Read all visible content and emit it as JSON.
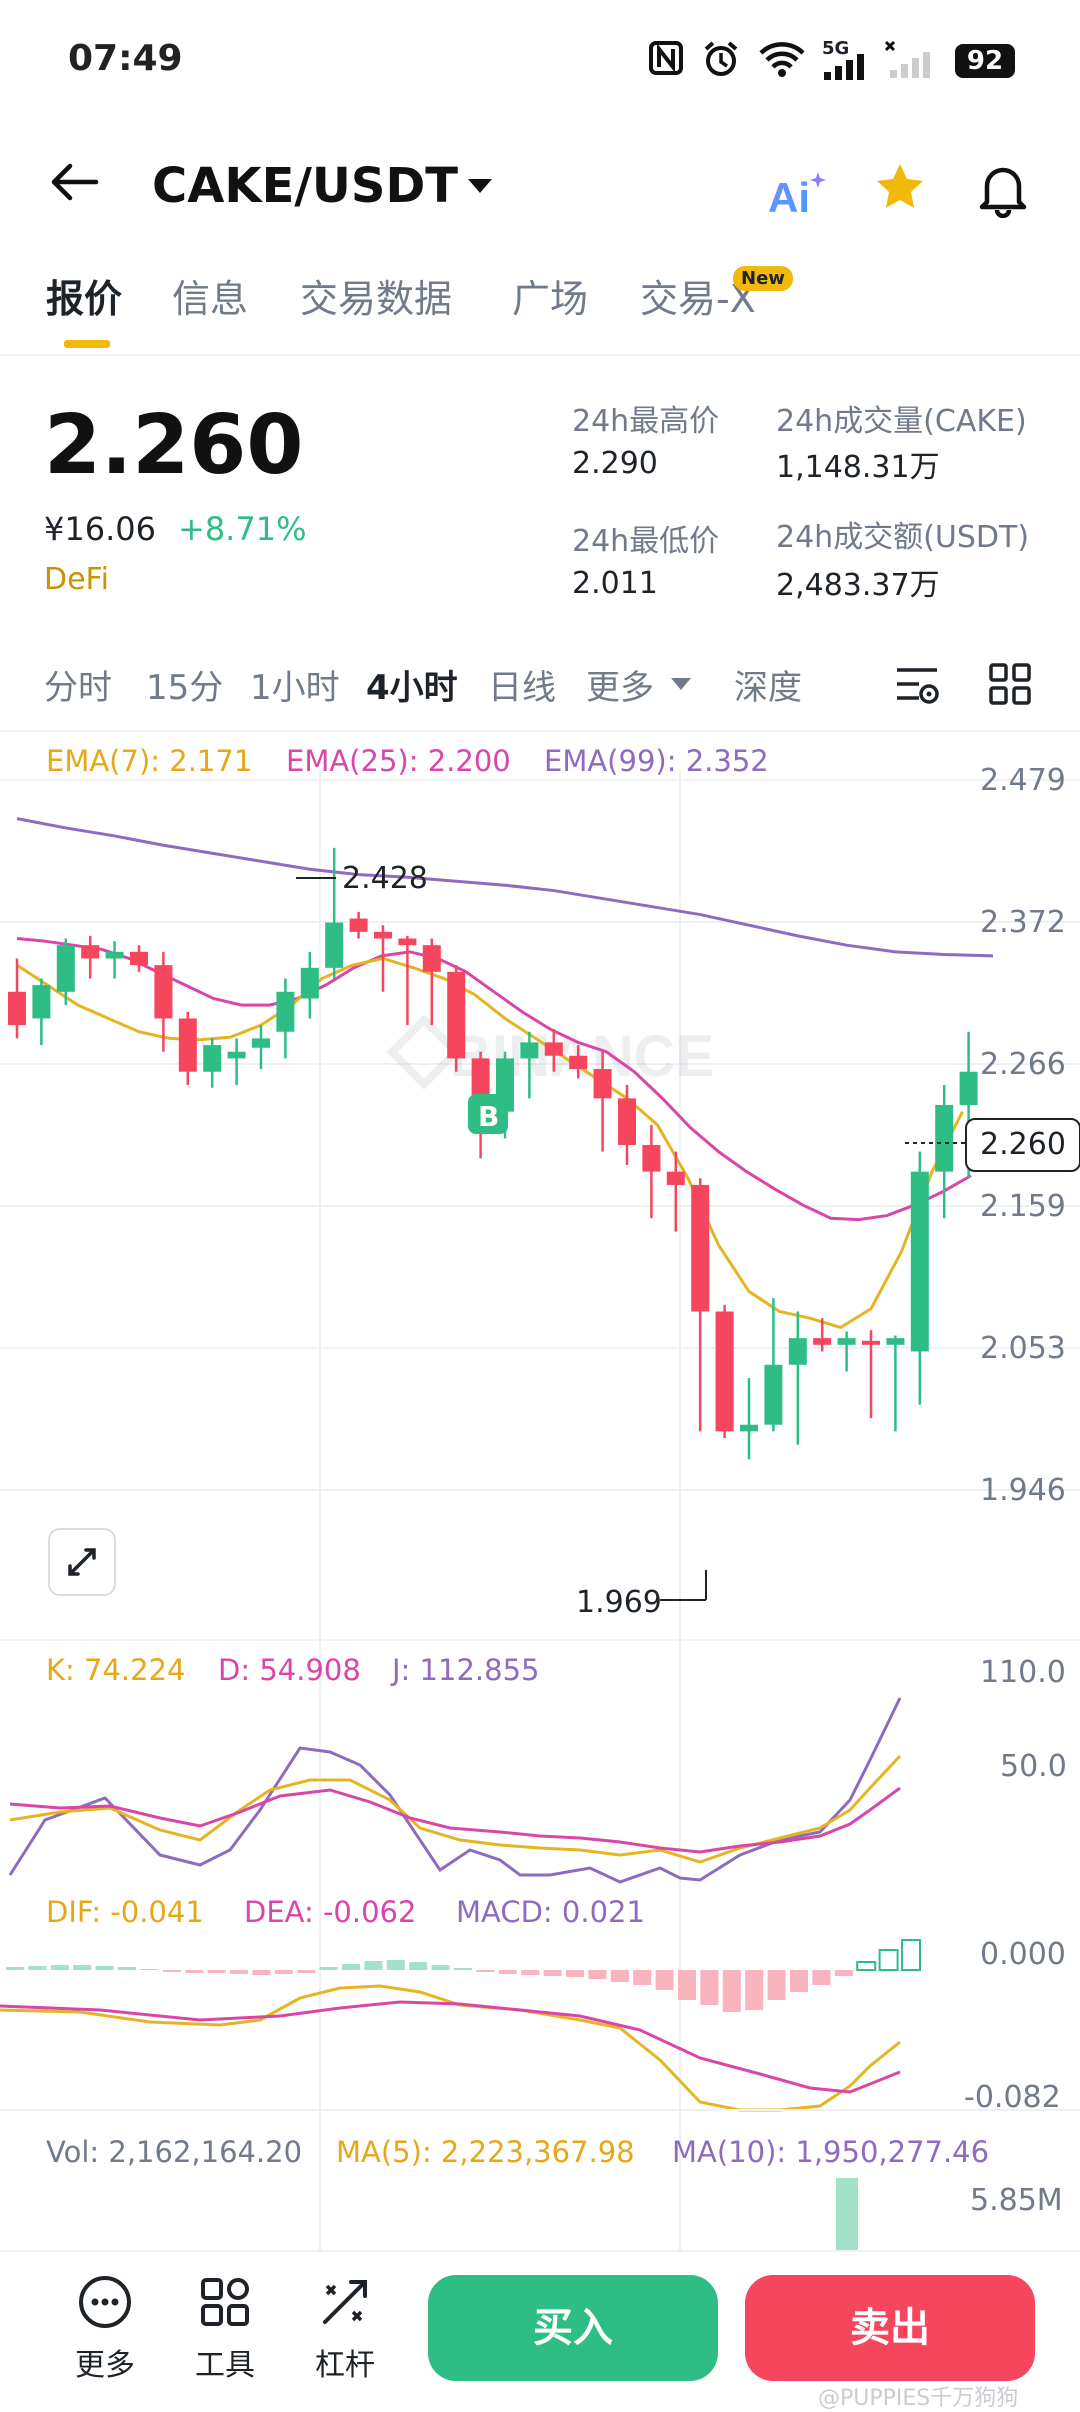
{
  "status": {
    "time": "07:49",
    "network": "5G",
    "battery": "92"
  },
  "header": {
    "pair": "CAKE/USDT"
  },
  "tabs": [
    {
      "label": "报价"
    },
    {
      "label": "信息"
    },
    {
      "label": "交易数据"
    },
    {
      "label": "广场"
    },
    {
      "label": "交易-X"
    }
  ],
  "new_badge": "New",
  "ticker": {
    "last_price": "2.260",
    "cny_price": "¥16.06",
    "change": "+8.71%",
    "tag": "DeFi",
    "high_label": "24h最高价",
    "high": "2.290",
    "low_label": "24h最低价",
    "low": "2.011",
    "vol_label": "24h成交量(CAKE)",
    "vol": "1,148.31万",
    "amt_label": "24h成交额(USDT)",
    "amt": "2,483.37万"
  },
  "intervals": [
    "分时",
    "15分",
    "1小时",
    "4小时",
    "日线",
    "更多",
    "深度"
  ],
  "ema": {
    "ema7": "EMA(7): 2.171",
    "ema25": "EMA(25): 2.200",
    "ema99": "EMA(99): 2.352"
  },
  "price_axis": [
    "2.479",
    "2.372",
    "2.266",
    "2.159",
    "2.053",
    "1.946"
  ],
  "price_tag": "2.260",
  "high_marker": "2.428",
  "low_marker": "1.969",
  "marker_b": "B",
  "watermark": "BINANCE",
  "kdj": {
    "k": "K: 74.224",
    "d": "D: 54.908",
    "j": "J: 112.855",
    "axis": [
      "110.0",
      "50.0"
    ]
  },
  "macd": {
    "dif": "DIF: -0.041",
    "dea": "DEA: -0.062",
    "macd": "MACD: 0.021",
    "axis": [
      "0.000",
      "-0.082"
    ]
  },
  "volume": {
    "vol": "Vol: 2,162,164.20",
    "ma5": "MA(5): 2,223,367.98",
    "ma10": "MA(10): 1,950,277.46",
    "axis": "5.85M"
  },
  "bottom": {
    "more": "更多",
    "tools": "工具",
    "leverage": "杠杆",
    "buy": "买入",
    "sell": "卖出"
  },
  "credit": "@PUPPIES千万狗狗",
  "colors": {
    "up": "#2ebd85",
    "down": "#f6465d",
    "accent": "#f0b90b",
    "ema7": "#e6b422",
    "ema25": "#d946a8",
    "ema99": "#8e6bbf"
  },
  "chart_data": {
    "type": "candlestick",
    "ylim": [
      1.946,
      2.479
    ],
    "candles": [
      {
        "o": 2.32,
        "h": 2.345,
        "l": 2.285,
        "c": 2.295
      },
      {
        "o": 2.3,
        "h": 2.33,
        "l": 2.28,
        "c": 2.325
      },
      {
        "o": 2.32,
        "h": 2.36,
        "l": 2.31,
        "c": 2.355
      },
      {
        "o": 2.355,
        "h": 2.362,
        "l": 2.33,
        "c": 2.345
      },
      {
        "o": 2.345,
        "h": 2.358,
        "l": 2.33,
        "c": 2.35
      },
      {
        "o": 2.35,
        "h": 2.355,
        "l": 2.335,
        "c": 2.34
      },
      {
        "o": 2.34,
        "h": 2.35,
        "l": 2.275,
        "c": 2.3
      },
      {
        "o": 2.3,
        "h": 2.305,
        "l": 2.25,
        "c": 2.26
      },
      {
        "o": 2.26,
        "h": 2.285,
        "l": 2.248,
        "c": 2.28
      },
      {
        "o": 2.27,
        "h": 2.285,
        "l": 2.25,
        "c": 2.275
      },
      {
        "o": 2.278,
        "h": 2.295,
        "l": 2.262,
        "c": 2.285
      },
      {
        "o": 2.29,
        "h": 2.33,
        "l": 2.27,
        "c": 2.32
      },
      {
        "o": 2.315,
        "h": 2.35,
        "l": 2.3,
        "c": 2.338
      },
      {
        "o": 2.338,
        "h": 2.428,
        "l": 2.33,
        "c": 2.372
      },
      {
        "o": 2.375,
        "h": 2.38,
        "l": 2.36,
        "c": 2.365
      },
      {
        "o": 2.365,
        "h": 2.37,
        "l": 2.32,
        "c": 2.36
      },
      {
        "o": 2.36,
        "h": 2.362,
        "l": 2.295,
        "c": 2.355
      },
      {
        "o": 2.355,
        "h": 2.36,
        "l": 2.295,
        "c": 2.335
      },
      {
        "o": 2.335,
        "h": 2.34,
        "l": 2.26,
        "c": 2.27
      },
      {
        "o": 2.27,
        "h": 2.275,
        "l": 2.195,
        "c": 2.225
      },
      {
        "o": 2.23,
        "h": 2.275,
        "l": 2.21,
        "c": 2.27
      },
      {
        "o": 2.27,
        "h": 2.29,
        "l": 2.24,
        "c": 2.282
      },
      {
        "o": 2.282,
        "h": 2.292,
        "l": 2.26,
        "c": 2.272
      },
      {
        "o": 2.272,
        "h": 2.28,
        "l": 2.255,
        "c": 2.262
      },
      {
        "o": 2.262,
        "h": 2.275,
        "l": 2.2,
        "c": 2.24
      },
      {
        "o": 2.24,
        "h": 2.25,
        "l": 2.19,
        "c": 2.205
      },
      {
        "o": 2.205,
        "h": 2.22,
        "l": 2.15,
        "c": 2.185
      },
      {
        "o": 2.185,
        "h": 2.2,
        "l": 2.14,
        "c": 2.175
      },
      {
        "o": 2.175,
        "h": 2.18,
        "l": 1.99,
        "c": 2.08
      },
      {
        "o": 2.08,
        "h": 2.085,
        "l": 1.985,
        "c": 1.99
      },
      {
        "o": 1.99,
        "h": 2.03,
        "l": 1.969,
        "c": 1.995
      },
      {
        "o": 1.995,
        "h": 2.09,
        "l": 1.99,
        "c": 2.04
      },
      {
        "o": 2.04,
        "h": 2.08,
        "l": 1.98,
        "c": 2.06
      },
      {
        "o": 2.06,
        "h": 2.075,
        "l": 2.05,
        "c": 2.055
      },
      {
        "o": 2.055,
        "h": 2.065,
        "l": 2.035,
        "c": 2.06
      },
      {
        "o": 2.058,
        "h": 2.066,
        "l": 2.0,
        "c": 2.055
      },
      {
        "o": 2.055,
        "h": 2.062,
        "l": 1.99,
        "c": 2.06
      },
      {
        "o": 2.05,
        "h": 2.2,
        "l": 2.01,
        "c": 2.185
      },
      {
        "o": 2.185,
        "h": 2.25,
        "l": 2.15,
        "c": 2.235
      },
      {
        "o": 2.235,
        "h": 2.29,
        "l": 2.18,
        "c": 2.26
      }
    ],
    "ema7": [
      2.34,
      2.325,
      2.31,
      2.3,
      2.29,
      2.285,
      2.284,
      2.286,
      2.295,
      2.31,
      2.33,
      2.34,
      2.345,
      2.338,
      2.33,
      2.318,
      2.3,
      2.285,
      2.27,
      2.255,
      2.24,
      2.22,
      2.18,
      2.13,
      2.095,
      2.08,
      2.075,
      2.068,
      2.082,
      2.125,
      2.185,
      2.23
    ],
    "ema25": [
      2.36,
      2.358,
      2.355,
      2.352,
      2.345,
      2.335,
      2.325,
      2.315,
      2.31,
      2.31,
      2.315,
      2.325,
      2.338,
      2.347,
      2.35,
      2.345,
      2.335,
      2.32,
      2.305,
      2.292,
      2.282,
      2.275,
      2.26,
      2.24,
      2.218,
      2.2,
      2.185,
      2.172,
      2.16,
      2.15,
      2.149,
      2.152,
      2.16,
      2.17,
      2.182
    ],
    "ema99": [
      2.45,
      2.443,
      2.437,
      2.43,
      2.424,
      2.418,
      2.412,
      2.408,
      2.406,
      2.403,
      2.4,
      2.396,
      2.39,
      2.384,
      2.378,
      2.37,
      2.362,
      2.355,
      2.35,
      2.348,
      2.347
    ]
  }
}
